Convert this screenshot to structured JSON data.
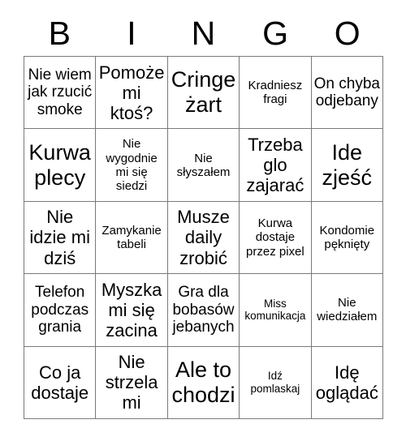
{
  "card": {
    "title": "BINGO",
    "header_letters": [
      "B",
      "I",
      "N",
      "G",
      "O"
    ],
    "columns": 5,
    "rows": 5,
    "colors": {
      "background": "#ffffff",
      "text": "#000000",
      "grid_line": "#7a7a7a"
    },
    "cells": [
      {
        "text": "Nie wiem jak rzucić smoke",
        "size": "fs-md",
        "col": "B",
        "row": 1
      },
      {
        "text": "Pomoże mi ktoś?",
        "size": "fs-lg",
        "col": "I",
        "row": 1
      },
      {
        "text": "Cringe żart",
        "size": "fs-xl",
        "col": "N",
        "row": 1
      },
      {
        "text": "Kradniesz fragi",
        "size": "fs-sm",
        "col": "G",
        "row": 1
      },
      {
        "text": "On chyba odjebany",
        "size": "fs-md",
        "col": "O",
        "row": 1
      },
      {
        "text": "Kurwa plecy",
        "size": "fs-xl",
        "col": "B",
        "row": 2
      },
      {
        "text": "Nie wygodnie mi się siedzi",
        "size": "fs-sm",
        "col": "I",
        "row": 2
      },
      {
        "text": "Nie słyszałem",
        "size": "fs-sm",
        "col": "N",
        "row": 2
      },
      {
        "text": "Trzeba glo zajarać",
        "size": "fs-lg",
        "col": "G",
        "row": 2
      },
      {
        "text": "Ide zjeść",
        "size": "fs-xl",
        "col": "O",
        "row": 2
      },
      {
        "text": "Nie idzie mi dziś",
        "size": "fs-lg",
        "col": "B",
        "row": 3
      },
      {
        "text": "Zamykanie tabeli",
        "size": "fs-sm",
        "col": "I",
        "row": 3
      },
      {
        "text": "Musze daily zrobić",
        "size": "fs-lg",
        "col": "N",
        "row": 3
      },
      {
        "text": "Kurwa dostaje przez pixel",
        "size": "fs-sm",
        "col": "G",
        "row": 3
      },
      {
        "text": "Kondomie pęknięty",
        "size": "fs-sm",
        "col": "O",
        "row": 3
      },
      {
        "text": "Telefon podczas grania",
        "size": "fs-md",
        "col": "B",
        "row": 4
      },
      {
        "text": "Myszka mi się zacina",
        "size": "fs-lg",
        "col": "I",
        "row": 4
      },
      {
        "text": "Gra dla bobasów jebanych",
        "size": "fs-md",
        "col": "N",
        "row": 4
      },
      {
        "text": "Miss komunikacja",
        "size": "fs-xs",
        "col": "G",
        "row": 4
      },
      {
        "text": "Nie wiedziałem",
        "size": "fs-sm",
        "col": "O",
        "row": 4
      },
      {
        "text": "Co ja dostaje",
        "size": "fs-lg",
        "col": "B",
        "row": 5
      },
      {
        "text": "Nie strzela mi",
        "size": "fs-lg",
        "col": "I",
        "row": 5
      },
      {
        "text": "Ale to chodzi",
        "size": "fs-xl",
        "col": "N",
        "row": 5
      },
      {
        "text": "Idź pomlaskaj",
        "size": "fs-xs",
        "col": "G",
        "row": 5
      },
      {
        "text": "Idę oglądać",
        "size": "fs-lg",
        "col": "O",
        "row": 5
      }
    ]
  }
}
